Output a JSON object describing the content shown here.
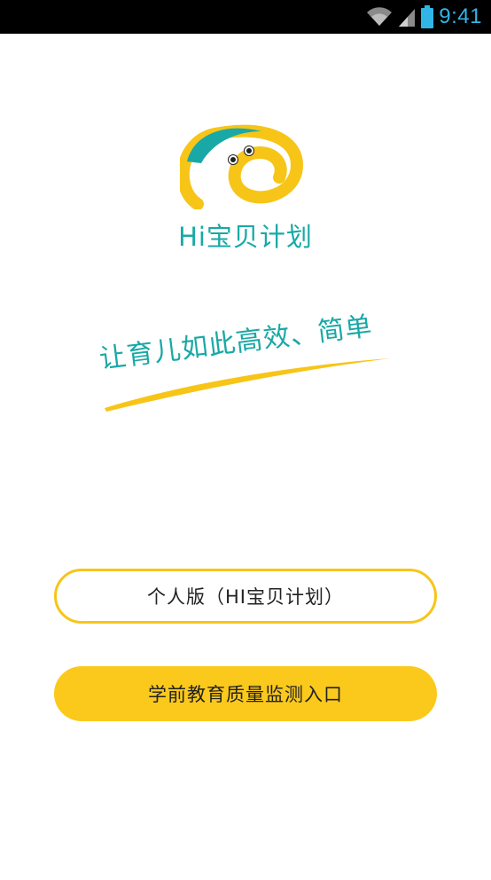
{
  "status_bar": {
    "time": "9:41",
    "icons": [
      "wifi-icon",
      "signal-icon",
      "battery-icon"
    ],
    "accent_color": "#31b5e6"
  },
  "app": {
    "name": "Hi宝贝计划",
    "slogan": "让育儿如此高效、简单",
    "brand_teal": "#18a9a6",
    "brand_yellow": "#f7c518"
  },
  "buttons": {
    "personal": "个人版（HI宝贝计划）",
    "preschool": "学前教育质量监测入口"
  }
}
